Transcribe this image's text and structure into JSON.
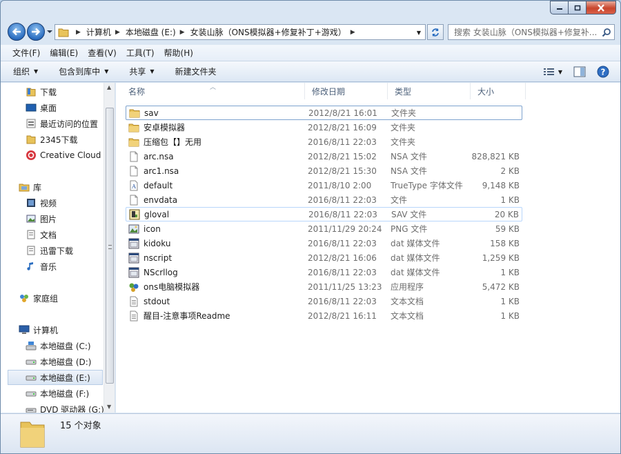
{
  "window": {
    "controls": {
      "minimize": "minimize",
      "maximize": "maximize",
      "close": "close"
    }
  },
  "address": {
    "crumbs": [
      "计算机",
      "本地磁盘 (E:)",
      "女装山脉（ONS模拟器+修复补丁+游戏）"
    ],
    "search_placeholder": "搜索 女装山脉（ONS模拟器+修复补..."
  },
  "menu": [
    "文件(F)",
    "编辑(E)",
    "查看(V)",
    "工具(T)",
    "帮助(H)"
  ],
  "commands": {
    "organize": "组织",
    "include_library": "包含到库中",
    "share": "共享",
    "new_folder": "新建文件夹"
  },
  "nav": {
    "favorites": [
      {
        "label": "下载",
        "icon": "folder-icon"
      },
      {
        "label": "桌面",
        "icon": "desktop-icon"
      },
      {
        "label": "最近访问的位置",
        "icon": "recent-places-icon"
      },
      {
        "label": "2345下载",
        "icon": "folder-icon"
      },
      {
        "label": "Creative Cloud",
        "icon": "creative-cloud-icon"
      }
    ],
    "libraries": {
      "label": "库",
      "items": [
        "视频",
        "图片",
        "文档",
        "迅雷下载",
        "音乐"
      ]
    },
    "homegroup": "家庭组",
    "computer": {
      "label": "计算机",
      "drives": [
        "本地磁盘 (C:)",
        "本地磁盘 (D:)",
        "本地磁盘 (E:)",
        "本地磁盘 (F:)",
        "DVD 驱动器 (G:)"
      ]
    },
    "selected": "本地磁盘 (E:)"
  },
  "columns": {
    "name": "名称",
    "date": "修改日期",
    "type": "类型",
    "size": "大小"
  },
  "files": [
    {
      "name": "sav",
      "date": "2012/8/21 16:01",
      "type": "文件夹",
      "size": "",
      "icon": "folder"
    },
    {
      "name": "安卓模拟器",
      "date": "2012/8/21 16:09",
      "type": "文件夹",
      "size": "",
      "icon": "folder"
    },
    {
      "name": "压缩包【】无用",
      "date": "2016/8/11 22:03",
      "type": "文件夹",
      "size": "",
      "icon": "folder"
    },
    {
      "name": "arc.nsa",
      "date": "2012/8/21 15:02",
      "type": "NSA 文件",
      "size": "828,821 KB",
      "icon": "file"
    },
    {
      "name": "arc1.nsa",
      "date": "2012/8/21 15:30",
      "type": "NSA 文件",
      "size": "2 KB",
      "icon": "file"
    },
    {
      "name": "default",
      "date": "2011/8/10 2:00",
      "type": "TrueType 字体文件",
      "size": "9,148 KB",
      "icon": "font"
    },
    {
      "name": "envdata",
      "date": "2016/8/11 22:03",
      "type": "文件",
      "size": "1 KB",
      "icon": "file"
    },
    {
      "name": "gloval",
      "date": "2016/8/11 22:03",
      "type": "SAV 文件",
      "size": "20 KB",
      "icon": "sav"
    },
    {
      "name": "icon",
      "date": "2011/11/29 20:24",
      "type": "PNG 文件",
      "size": "59 KB",
      "icon": "image"
    },
    {
      "name": "kidoku",
      "date": "2016/8/11 22:03",
      "type": "dat 媒体文件",
      "size": "158 KB",
      "icon": "dat"
    },
    {
      "name": "nscript",
      "date": "2012/8/21 16:06",
      "type": "dat 媒体文件",
      "size": "1,259 KB",
      "icon": "dat"
    },
    {
      "name": "NScrllog",
      "date": "2016/8/11 22:03",
      "type": "dat 媒体文件",
      "size": "1 KB",
      "icon": "dat"
    },
    {
      "name": "ons电脑模拟器",
      "date": "2011/11/25 13:23",
      "type": "应用程序",
      "size": "5,472 KB",
      "icon": "exe"
    },
    {
      "name": "stdout",
      "date": "2016/8/11 22:03",
      "type": "文本文档",
      "size": "1 KB",
      "icon": "text"
    },
    {
      "name": "醒目-注意事项Readme",
      "date": "2012/8/21 16:11",
      "type": "文本文档",
      "size": "1 KB",
      "icon": "text"
    }
  ],
  "status": {
    "count": "15 个对象"
  }
}
